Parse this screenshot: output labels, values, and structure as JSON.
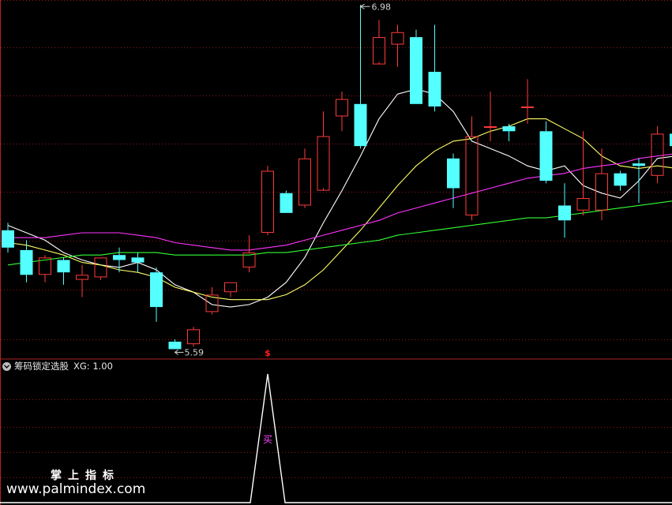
{
  "colors": {
    "background": "#000000",
    "grid": "#8b1a1a",
    "up_candle": "#ff3b3b",
    "down_candle": "#54ffff",
    "ma_fast": "#ffffff",
    "ma_mid": "#ffff66",
    "ma_slow": "#ff33ff",
    "ma_long": "#33ff33",
    "signal_line": "#ffffff",
    "signal_mark": "#ff44ff",
    "annotation": "#d0d0d0"
  },
  "price_panel": {
    "high_label": "6.98",
    "low_label": "5.59",
    "marker_symbol": "$",
    "ylim": [
      5.55,
      7.0
    ]
  },
  "indicator_panel": {
    "name": "筹码锁定选股",
    "value_label": "XG: 1.00",
    "signal_text": "买",
    "toggle_icon": "chevron-down-icon"
  },
  "watermark": {
    "title": "掌上指标",
    "url": "www.palmindex.com"
  },
  "chart_data": [
    {
      "type": "candlestick",
      "ylim": [
        5.55,
        7.0
      ],
      "annotations": [
        "6.98",
        "5.59"
      ],
      "candles": [
        {
          "o": 6.07,
          "c": 6.0,
          "h": 6.1,
          "l": 5.98
        },
        {
          "o": 5.99,
          "c": 5.89,
          "h": 6.03,
          "l": 5.86
        },
        {
          "o": 5.89,
          "c": 5.96,
          "h": 5.97,
          "l": 5.86
        },
        {
          "o": 5.95,
          "c": 5.9,
          "h": 5.96,
          "l": 5.85
        },
        {
          "o": 5.87,
          "c": 5.89,
          "h": 5.93,
          "l": 5.8
        },
        {
          "o": 5.88,
          "c": 5.96,
          "h": 5.96,
          "l": 5.87
        },
        {
          "o": 5.97,
          "c": 5.95,
          "h": 6.0,
          "l": 5.9
        },
        {
          "o": 5.96,
          "c": 5.94,
          "h": 5.98,
          "l": 5.9
        },
        {
          "o": 5.9,
          "c": 5.76,
          "h": 5.92,
          "l": 5.7
        },
        {
          "o": 5.62,
          "c": 5.59,
          "h": 5.63,
          "l": 5.59
        },
        {
          "o": 5.61,
          "c": 5.67,
          "h": 5.68,
          "l": 5.6
        },
        {
          "o": 5.74,
          "c": 5.81,
          "h": 5.84,
          "l": 5.73
        },
        {
          "o": 5.82,
          "c": 5.86,
          "h": 5.86,
          "l": 5.8
        },
        {
          "o": 5.92,
          "c": 5.98,
          "h": 6.05,
          "l": 5.9
        },
        {
          "o": 6.06,
          "c": 6.31,
          "h": 6.33,
          "l": 6.05
        },
        {
          "o": 6.22,
          "c": 6.14,
          "h": 6.23,
          "l": 6.14
        },
        {
          "o": 6.17,
          "c": 6.36,
          "h": 6.4,
          "l": 6.16
        },
        {
          "o": 6.23,
          "c": 6.45,
          "h": 6.55,
          "l": 6.24
        },
        {
          "o": 6.53,
          "c": 6.6,
          "h": 6.63,
          "l": 6.47
        },
        {
          "o": 6.58,
          "c": 6.41,
          "h": 6.98,
          "l": 6.4
        },
        {
          "o": 6.74,
          "c": 6.85,
          "h": 6.92,
          "l": 6.75
        },
        {
          "o": 6.82,
          "c": 6.87,
          "h": 6.9,
          "l": 6.73
        },
        {
          "o": 6.85,
          "c": 6.58,
          "h": 6.88,
          "l": 6.58
        },
        {
          "o": 6.71,
          "c": 6.57,
          "h": 6.9,
          "l": 6.55
        },
        {
          "o": 6.36,
          "c": 6.24,
          "h": 6.38,
          "l": 6.16
        },
        {
          "o": 6.13,
          "c": 6.45,
          "h": 6.53,
          "l": 6.11
        },
        {
          "o": 6.49,
          "c": 6.49,
          "h": 6.63,
          "l": 6.43
        },
        {
          "o": 6.49,
          "c": 6.47,
          "h": 6.5,
          "l": 6.43
        },
        {
          "o": 6.57,
          "c": 6.57,
          "h": 6.68,
          "l": 6.5
        },
        {
          "o": 6.47,
          "c": 6.27,
          "h": 6.51,
          "l": 6.26
        },
        {
          "o": 6.17,
          "c": 6.11,
          "h": 6.26,
          "l": 6.04
        },
        {
          "o": 6.15,
          "c": 6.2,
          "h": 6.47,
          "l": 6.13
        },
        {
          "o": 6.15,
          "c": 6.3,
          "h": 6.4,
          "l": 6.11
        },
        {
          "o": 6.3,
          "c": 6.25,
          "h": 6.31,
          "l": 6.23
        },
        {
          "o": 6.34,
          "c": 6.33,
          "h": 6.36,
          "l": 6.18
        },
        {
          "o": 6.29,
          "c": 6.46,
          "h": 6.49,
          "l": 6.26
        },
        {
          "o": 6.46,
          "c": 6.41,
          "h": 6.46,
          "l": 6.38
        },
        {
          "o": 6.4,
          "c": 6.57,
          "h": 6.61,
          "l": 6.37
        }
      ],
      "moving_averages": [
        {
          "values": [
            6.09,
            6.06,
            6.03,
            5.98,
            5.95,
            5.93,
            5.92,
            5.94,
            5.91,
            5.85,
            5.82,
            5.77,
            5.76,
            5.77,
            5.8,
            5.86,
            5.96,
            6.1,
            6.23,
            6.37,
            6.52,
            6.62,
            6.64,
            6.62,
            6.55,
            6.43,
            6.4,
            6.37,
            6.33,
            6.31,
            6.33,
            6.25,
            6.22,
            6.2,
            6.27,
            6.36,
            6.37,
            6.4
          ]
        },
        {
          "values": [
            6.02,
            6.01,
            5.99,
            5.97,
            5.94,
            5.93,
            5.91,
            5.9,
            5.88,
            5.84,
            5.82,
            5.8,
            5.79,
            5.79,
            5.79,
            5.81,
            5.85,
            5.91,
            5.99,
            6.07,
            6.16,
            6.25,
            6.33,
            6.39,
            6.43,
            6.44,
            6.47,
            6.49,
            6.52,
            6.52,
            6.48,
            6.44,
            6.37,
            6.33,
            6.32,
            6.33,
            6.32,
            6.34
          ]
        },
        {
          "values": [
            6.04,
            6.04,
            6.04,
            6.05,
            6.06,
            6.06,
            6.06,
            6.05,
            6.04,
            6.02,
            6.01,
            6.0,
            5.99,
            5.99,
            6.0,
            6.01,
            6.03,
            6.05,
            6.07,
            6.09,
            6.11,
            6.14,
            6.16,
            6.18,
            6.2,
            6.22,
            6.24,
            6.26,
            6.28,
            6.29,
            6.3,
            6.32,
            6.33,
            6.34,
            6.36,
            6.37,
            6.38,
            6.39
          ]
        },
        {
          "values": [
            5.93,
            5.94,
            5.95,
            5.96,
            5.97,
            5.97,
            5.98,
            5.98,
            5.98,
            5.97,
            5.97,
            5.97,
            5.97,
            5.97,
            5.98,
            5.98,
            5.99,
            6.0,
            6.01,
            6.02,
            6.03,
            6.05,
            6.06,
            6.07,
            6.08,
            6.09,
            6.1,
            6.11,
            6.12,
            6.12,
            6.13,
            6.14,
            6.15,
            6.16,
            6.17,
            6.18,
            6.19,
            6.21
          ]
        }
      ]
    },
    {
      "type": "line",
      "title": "筹码锁定选股",
      "ylim": [
        0,
        1
      ],
      "series": [
        {
          "name": "XG",
          "x": [
            14
          ],
          "values": [
            1
          ]
        }
      ]
    }
  ]
}
